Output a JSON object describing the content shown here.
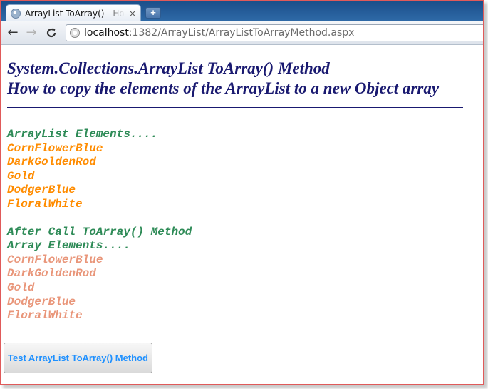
{
  "browser": {
    "tab_title": "ArrayList ToArray() - How to",
    "tab_close": "×",
    "new_tab": "+",
    "back": "←",
    "forward": "→",
    "reload": "C",
    "url_host": "localhost",
    "url_path": ":1382/ArrayList/ArrayListToArrayMethod.aspx"
  },
  "page": {
    "heading_line1": "System.Collections.ArrayList ToArray() Method",
    "heading_line2": "How to copy the elements of the ArrayList to a new Object array",
    "arraylist_header": "ArrayList Elements....",
    "arraylist_items": [
      "CornFlowerBlue",
      "DarkGoldenRod",
      "Gold",
      "DodgerBlue",
      "FloralWhite"
    ],
    "after_call_label": "After Call ToArray() Method",
    "array_header": "Array Elements....",
    "array_items": [
      "CornFlowerBlue",
      "DarkGoldenRod",
      "Gold",
      "DodgerBlue",
      "FloralWhite"
    ],
    "button_label": "Test ArrayList ToArray() Method"
  },
  "colors": {
    "heading": "#191970",
    "label_green": "#2e8b57",
    "list_orange": "#ff8c00",
    "list_salmon": "#e9967a",
    "button_text": "#1e90ff"
  }
}
